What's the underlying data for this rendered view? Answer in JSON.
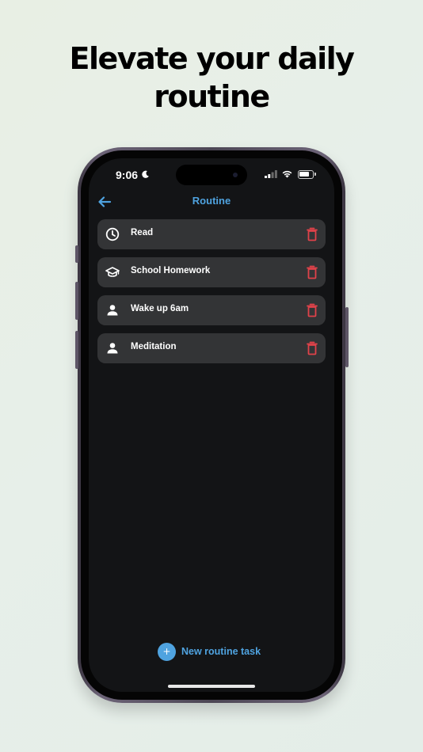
{
  "headline": {
    "line1": "Elevate your daily",
    "line2": "routine"
  },
  "status_bar": {
    "time": "9:06",
    "icons": [
      "moon-icon",
      "signal-icon",
      "wifi-icon",
      "battery-icon"
    ]
  },
  "nav": {
    "back_icon": "arrow-left-icon",
    "title": "Routine"
  },
  "tasks": [
    {
      "label": "Read",
      "icon": "clock-icon"
    },
    {
      "label": "School Homework",
      "icon": "graduation-cap-icon"
    },
    {
      "label": "Wake up 6am",
      "icon": "person-icon"
    },
    {
      "label": "Meditation",
      "icon": "person-icon"
    }
  ],
  "new_task": {
    "icon_text": "+",
    "label": "New routine task"
  },
  "colors": {
    "accent": "#4fa3e0",
    "delete": "#e0424a",
    "task_bg": "#333436",
    "screen_bg": "#131416"
  }
}
